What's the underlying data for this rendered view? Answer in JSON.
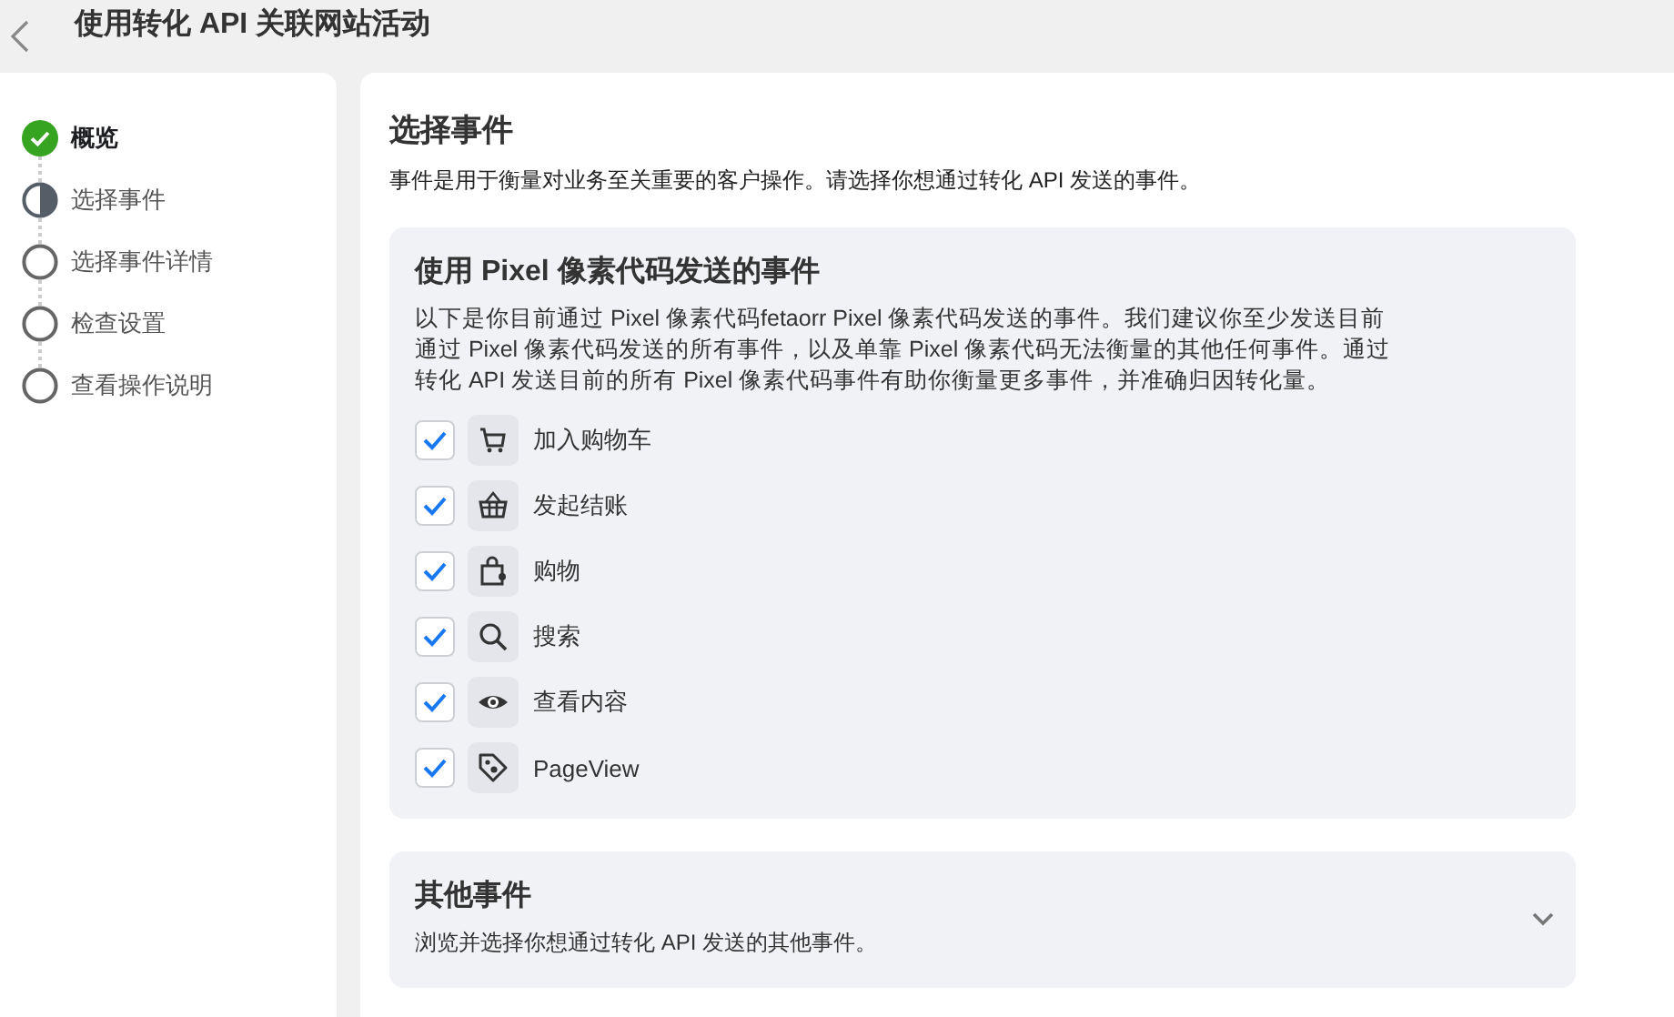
{
  "header": {
    "title": "使用转化 API 关联网站活动"
  },
  "steps": [
    {
      "label": "概览",
      "completed": true,
      "selected": false
    },
    {
      "label": "选择事件",
      "completed": false,
      "selected": true
    },
    {
      "label": "选择事件详情",
      "completed": false,
      "selected": false
    },
    {
      "label": "检查设置",
      "completed": false,
      "selected": false
    },
    {
      "label": "查看操作说明",
      "completed": false,
      "selected": false
    }
  ],
  "section": {
    "title": "选择事件",
    "description": "事件是用于衡量对业务至关重要的客户操作。请选择你想通过转化 API 发送的事件。"
  },
  "pixel_card": {
    "title": "使用 Pixel 像素代码发送的事件",
    "description": "以下是你目前通过 Pixel 像素代码fetaorr Pixel 像素代码发送的事件。我们建议你至少发送目前通过 Pixel 像素代码发送的所有事件，以及单靠 Pixel 像素代码无法衡量的其他任何事件。通过转化 API 发送目前的所有 Pixel 像素代码事件有助你衡量更多事件，并准确归因转化量。",
    "events": [
      {
        "label": "加入购物车",
        "checked": true
      },
      {
        "label": "发起结账",
        "checked": true
      },
      {
        "label": "购物",
        "checked": true
      },
      {
        "label": "搜索",
        "checked": true
      },
      {
        "label": "查看内容",
        "checked": true
      },
      {
        "label": "PageView",
        "checked": true
      }
    ]
  },
  "other_card": {
    "title": "其他事件",
    "description": "浏览并选择你想通过转化 API 发送的其他事件。",
    "expanded": false
  }
}
